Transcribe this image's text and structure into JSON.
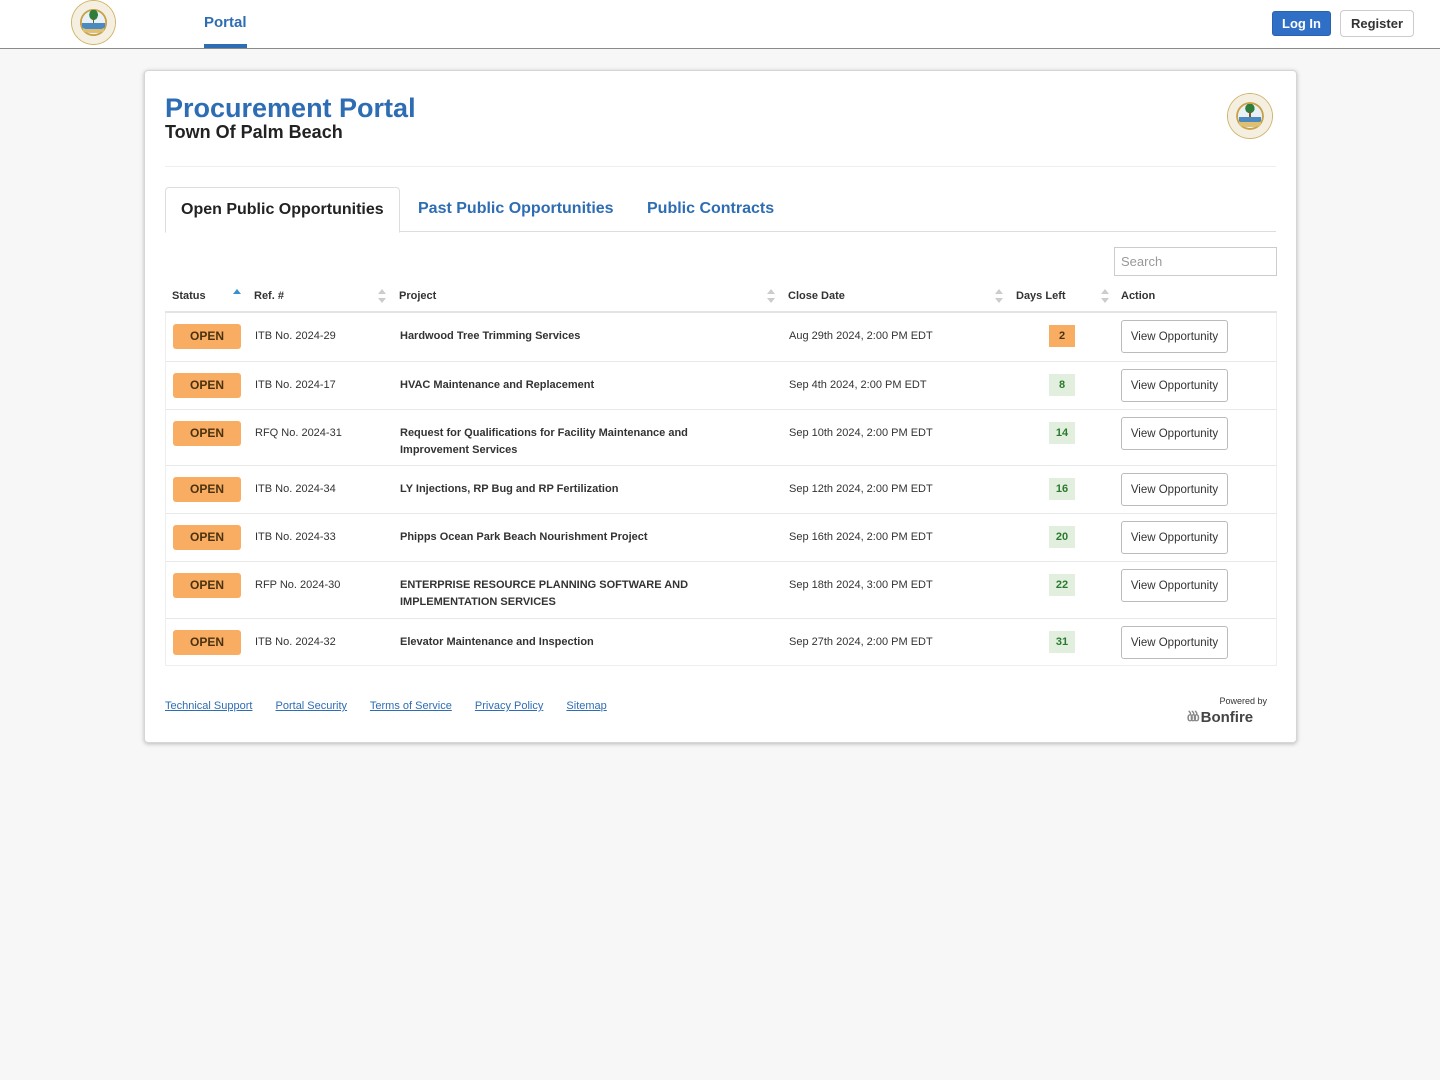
{
  "topbar": {
    "logo_alt": "Town of Palm Beach seal",
    "nav_portal": "Portal",
    "login_label": "Log In",
    "register_label": "Register"
  },
  "header": {
    "title": "Procurement Portal",
    "subtitle": "Town Of Palm Beach"
  },
  "tabs": [
    {
      "label": "Open Public Opportunities",
      "active": true
    },
    {
      "label": "Past Public Opportunities",
      "active": false
    },
    {
      "label": "Public Contracts",
      "active": false
    }
  ],
  "search": {
    "placeholder": "Search",
    "value": ""
  },
  "table": {
    "columns": [
      "Status",
      "Ref. #",
      "Project",
      "Close Date",
      "Days Left",
      "Action"
    ],
    "sorted_column": "Status",
    "sort_direction": "ascending",
    "rows": [
      {
        "status": "OPEN",
        "ref": "ITB No. 2024-29",
        "project": "Hardwood Tree Trimming Services",
        "close_date": "Aug 29th 2024, 2:00 PM EDT",
        "days_left": "2",
        "action": "View Opportunity"
      },
      {
        "status": "OPEN",
        "ref": "ITB No. 2024-17",
        "project": "HVAC Maintenance and Replacement",
        "close_date": "Sep 4th 2024, 2:00 PM EDT",
        "days_left": "8",
        "action": "View Opportunity"
      },
      {
        "status": "OPEN",
        "ref": "RFQ No. 2024-31",
        "project": "Request for Qualifications for Facility Maintenance and Improvement Services",
        "close_date": "Sep 10th 2024, 2:00 PM EDT",
        "days_left": "14",
        "action": "View Opportunity"
      },
      {
        "status": "OPEN",
        "ref": "ITB No. 2024-34",
        "project": "LY Injections, RP Bug and RP Fertilization",
        "close_date": "Sep 12th 2024, 2:00 PM EDT",
        "days_left": "16",
        "action": "View Opportunity"
      },
      {
        "status": "OPEN",
        "ref": "ITB No. 2024-33",
        "project": "Phipps Ocean Park Beach Nourishment Project",
        "close_date": "Sep 16th 2024, 2:00 PM EDT",
        "days_left": "20",
        "action": "View Opportunity"
      },
      {
        "status": "OPEN",
        "ref": "RFP No. 2024-30",
        "project": "ENTERPRISE RESOURCE PLANNING SOFTWARE AND IMPLEMENTATION SERVICES",
        "close_date": "Sep 18th 2024, 3:00 PM EDT",
        "days_left": "22",
        "action": "View Opportunity"
      },
      {
        "status": "OPEN",
        "ref": "ITB No. 2024-32",
        "project": "Elevator Maintenance and Inspection",
        "close_date": "Sep 27th 2024, 2:00 PM EDT",
        "days_left": "31",
        "action": "View Opportunity"
      }
    ]
  },
  "footer": {
    "links": [
      "Technical Support",
      "Portal Security",
      "Terms of Service",
      "Privacy Policy",
      "Sitemap"
    ],
    "powered_by": "Powered by",
    "brand": "Bonfire"
  },
  "colors": {
    "accent": "#2e6db3",
    "login_bg": "#2f6fc5",
    "open_badge": "#f9ad63",
    "days_ok_bg": "#e2efdf",
    "days_ok_text": "#2a7a2e",
    "page_bg": "#f7f7f7"
  }
}
